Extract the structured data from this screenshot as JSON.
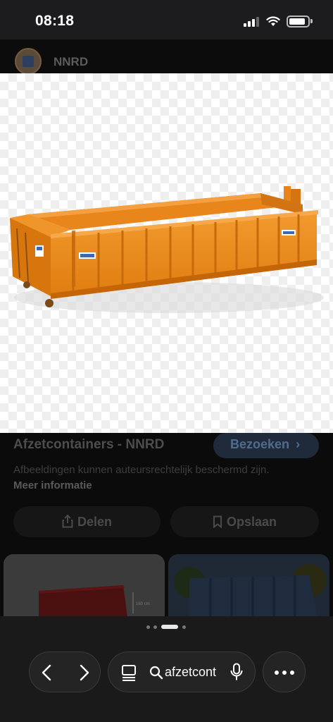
{
  "status": {
    "time": "08:18"
  },
  "site": {
    "name": "NNRD"
  },
  "result": {
    "title": "Afzetcontainers - NNRD",
    "visit_label": "Bezoeken",
    "copyright_text": "Afbeeldingen kunnen auteursrechtelijk beschermd zijn.",
    "more_info_label": "Meer informatie",
    "share_label": "Delen",
    "save_label": "Opslaan"
  },
  "toolbar": {
    "search_text": "afzetcont"
  },
  "icons": [
    "signal-icon",
    "wifi-icon",
    "battery-icon",
    "chevron-right-icon",
    "share-icon",
    "bookmark-icon",
    "back-icon",
    "forward-icon",
    "tabs-icon",
    "search-icon",
    "microphone-icon",
    "more-icon"
  ],
  "colors": {
    "container_orange": "#f08a1a",
    "visit_button_bg": "#1f2b3a",
    "toolbar_bg": "#1a1a1a"
  }
}
